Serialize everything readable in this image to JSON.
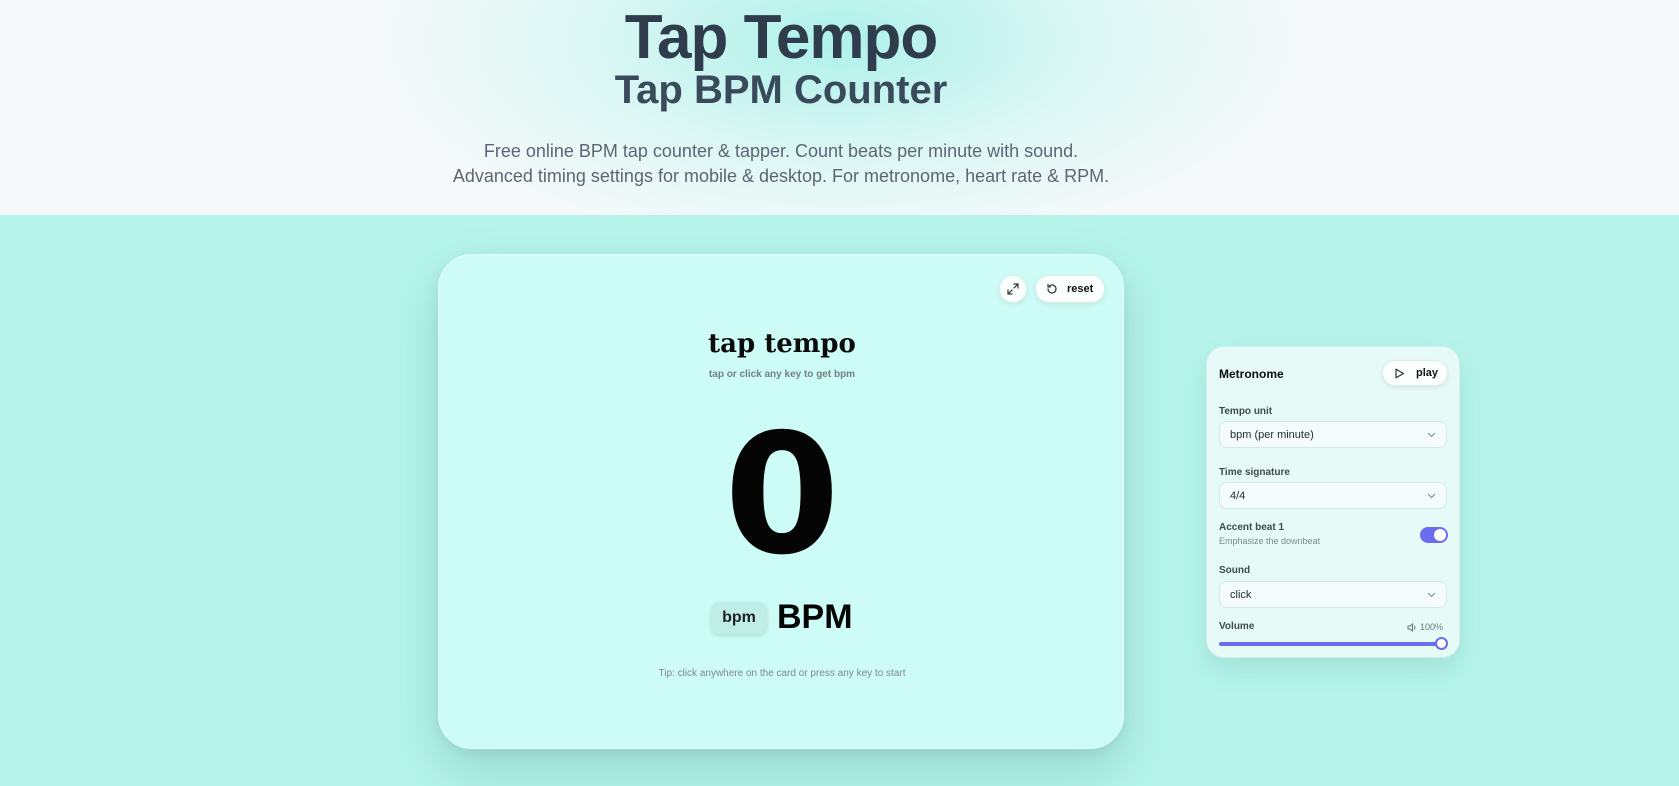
{
  "hero": {
    "title": "Tap Tempo",
    "subtitle": "Tap BPM Counter",
    "description_line1": "Free online BPM tap counter & tapper. Count beats per minute with sound.",
    "description_line2": "Advanced timing settings for mobile & desktop. For metronome, heart rate & RPM."
  },
  "tap_card": {
    "expand_icon": "expand-icon",
    "reset_icon": "reset-icon",
    "reset_label": "reset",
    "title": "tap tempo",
    "hint": "tap or click any key to get bpm",
    "bpm_value": "0",
    "unit_badge": "bpm",
    "unit_label": "BPM",
    "tip": "Tip: click anywhere on the card or press any key to start"
  },
  "metronome": {
    "title": "Metronome",
    "play_icon": "play-icon",
    "play_label": "play",
    "tempo_unit_label": "Tempo unit",
    "tempo_unit_value": "bpm (per minute)",
    "time_signature_label": "Time signature",
    "time_signature_value": "4/4",
    "accent_label": "Accent beat 1",
    "accent_sub": "Emphasize the downbeat",
    "accent_on": true,
    "sound_label": "Sound",
    "sound_value": "click",
    "volume_label": "Volume",
    "volume_icon": "speaker-icon",
    "volume_text": "100%",
    "volume_level": 100
  },
  "colors": {
    "page_bg": "#b6f4ea",
    "card_bg": "#ccfcf5",
    "accent": "#6b6cf0",
    "title": "#2f3c4c"
  }
}
